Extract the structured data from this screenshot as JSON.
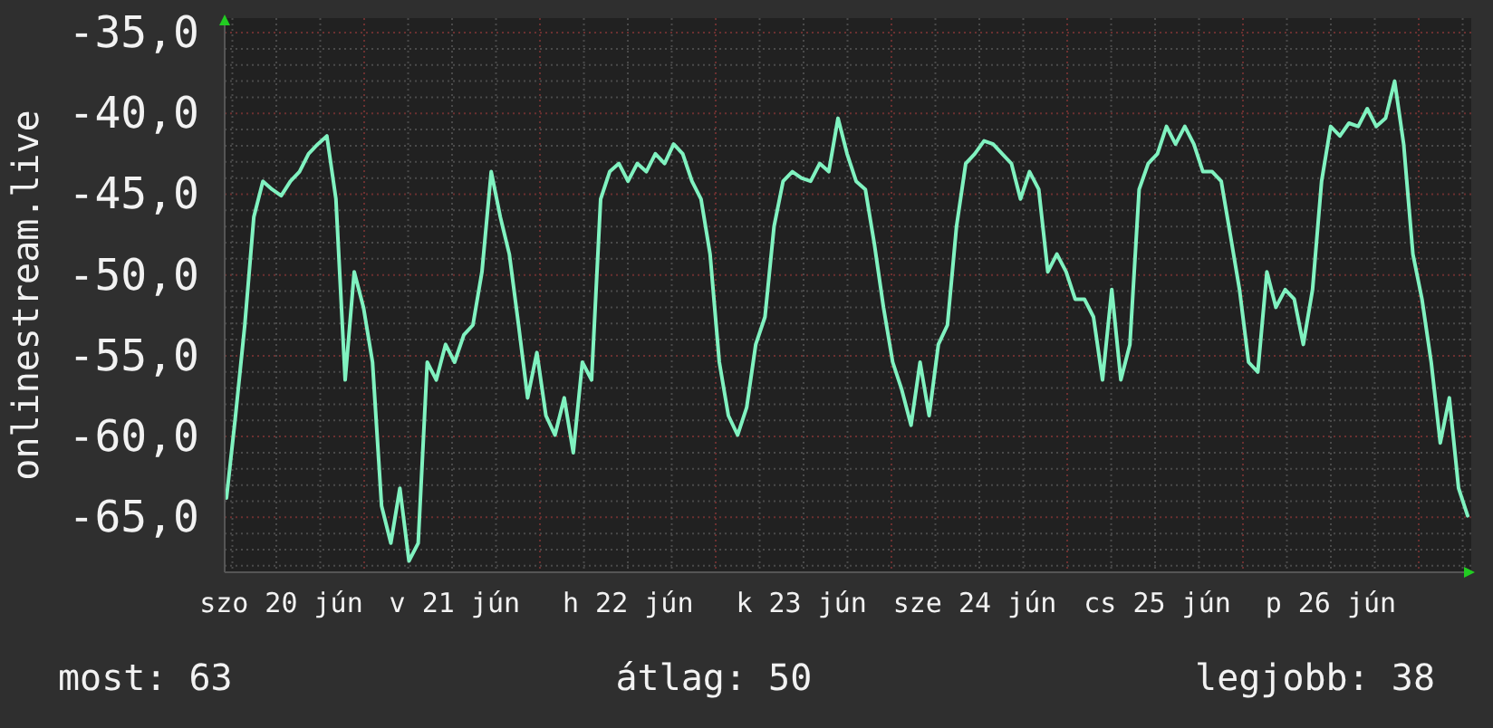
{
  "chart": {
    "chart_data": {
      "type": "line",
      "grid": true,
      "ylabel": "onlinestream.live",
      "ylim": [
        -68.4,
        -34.1
      ],
      "yticks": [
        {
          "value": -35,
          "label": "-35,0"
        },
        {
          "value": -40,
          "label": "-40,0"
        },
        {
          "value": -45,
          "label": "-45,0"
        },
        {
          "value": -50,
          "label": "-50,0"
        },
        {
          "value": -55,
          "label": "-55,0"
        },
        {
          "value": -60,
          "label": "-60,0"
        },
        {
          "value": -65,
          "label": "-65,0"
        }
      ],
      "categories": [
        null,
        null,
        null,
        null,
        null,
        null,
        "szo 20 jún",
        null,
        null,
        null,
        null,
        null,
        null,
        null,
        null,
        null,
        null,
        null,
        null,
        null,
        null,
        null,
        null,
        null,
        null,
        "v 21 jún",
        null,
        null,
        null,
        null,
        null,
        null,
        null,
        null,
        null,
        null,
        null,
        null,
        null,
        null,
        null,
        null,
        null,
        null,
        "h 22 jún",
        null,
        null,
        null,
        null,
        null,
        null,
        null,
        null,
        null,
        null,
        null,
        null,
        null,
        null,
        null,
        null,
        null,
        null,
        "k 23 jún",
        null,
        null,
        null,
        null,
        null,
        null,
        null,
        null,
        null,
        null,
        null,
        null,
        null,
        null,
        null,
        null,
        null,
        null,
        "sze 24 jún",
        null,
        null,
        null,
        null,
        null,
        null,
        null,
        null,
        null,
        null,
        null,
        null,
        null,
        null,
        null,
        null,
        null,
        null,
        null,
        "cs 25 jún",
        null,
        null,
        null,
        null,
        null,
        null,
        null,
        null,
        null,
        null,
        null,
        null,
        null,
        null,
        null,
        null,
        null,
        null,
        "p 26 jún",
        null,
        null,
        null,
        null,
        null,
        null,
        null,
        null,
        null,
        null,
        null,
        null,
        null,
        null,
        null
      ],
      "series": [
        {
          "color": "#80f2c0",
          "values": [
            -63.8,
            -58.7,
            -53.1,
            -46.4,
            -44.2,
            -44.7,
            -45.1,
            -44.2,
            -43.6,
            -42.5,
            -41.9,
            -41.4,
            -45.3,
            -56.5,
            -49.8,
            -52.0,
            -55.4,
            -64.3,
            -66.6,
            -63.2,
            -67.7,
            -66.6,
            -55.4,
            -56.5,
            -54.3,
            -55.4,
            -53.7,
            -53.1,
            -49.8,
            -43.6,
            -46.4,
            -48.7,
            -53.1,
            -57.6,
            -54.8,
            -58.7,
            -59.9,
            -57.6,
            -61.0,
            -55.4,
            -56.5,
            -45.3,
            -43.6,
            -43.1,
            -44.2,
            -43.1,
            -43.6,
            -42.5,
            -43.1,
            -41.9,
            -42.5,
            -44.2,
            -45.3,
            -48.7,
            -55.4,
            -58.7,
            -59.9,
            -58.2,
            -54.3,
            -52.6,
            -47.0,
            -44.2,
            -43.6,
            -44.0,
            -44.2,
            -43.1,
            -43.6,
            -40.3,
            -42.5,
            -44.2,
            -44.7,
            -48.1,
            -52.0,
            -55.4,
            -57.1,
            -59.3,
            -55.4,
            -58.7,
            -54.3,
            -53.1,
            -47.0,
            -43.1,
            -42.5,
            -41.7,
            -41.9,
            -42.5,
            -43.1,
            -45.3,
            -43.6,
            -44.7,
            -49.8,
            -48.7,
            -49.8,
            -51.5,
            -51.5,
            -52.6,
            -56.5,
            -50.9,
            -56.5,
            -54.3,
            -44.7,
            -43.1,
            -42.5,
            -40.8,
            -41.9,
            -40.8,
            -41.9,
            -43.6,
            -43.6,
            -44.2,
            -47.5,
            -50.9,
            -55.4,
            -56.0,
            -49.8,
            -52.0,
            -50.9,
            -51.5,
            -54.3,
            -50.9,
            -44.2,
            -40.8,
            -41.4,
            -40.6,
            -40.8,
            -39.7,
            -40.8,
            -40.3,
            -38.0,
            -41.9,
            -48.7,
            -51.5,
            -55.4,
            -60.4,
            -57.6,
            -63.2,
            -64.9
          ]
        }
      ]
    }
  },
  "stats": [
    {
      "label": "most: 63"
    },
    {
      "label": "átlag: 50"
    },
    {
      "label": "legjobb: 38"
    }
  ]
}
